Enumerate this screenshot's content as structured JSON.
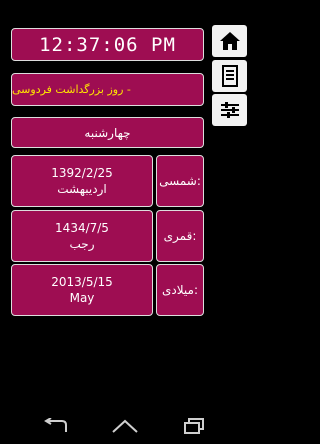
{
  "clock": {
    "time": "12:37:06 PM"
  },
  "event": {
    "text": "- روز بزرگداشت فردوسی"
  },
  "weekday": {
    "label": "چهارشنبه"
  },
  "dates": [
    {
      "date": "1392/2/25",
      "month": "اردیبهشت",
      "calendar_label": "شمسی:"
    },
    {
      "date": "1434/7/5",
      "month": "رجب",
      "calendar_label": "قمری:"
    },
    {
      "date": "2013/5/15",
      "month": "May",
      "calendar_label": "میلادی:"
    }
  ],
  "sidebar": {
    "icons": [
      "home-icon",
      "document-icon",
      "settings-sliders-icon"
    ]
  },
  "navbar": {
    "icons": [
      "back-icon",
      "home-nav-icon",
      "recent-apps-icon"
    ]
  },
  "colors": {
    "card": "#9e0d52",
    "event_text": "#ffe600",
    "background": "#000000"
  }
}
